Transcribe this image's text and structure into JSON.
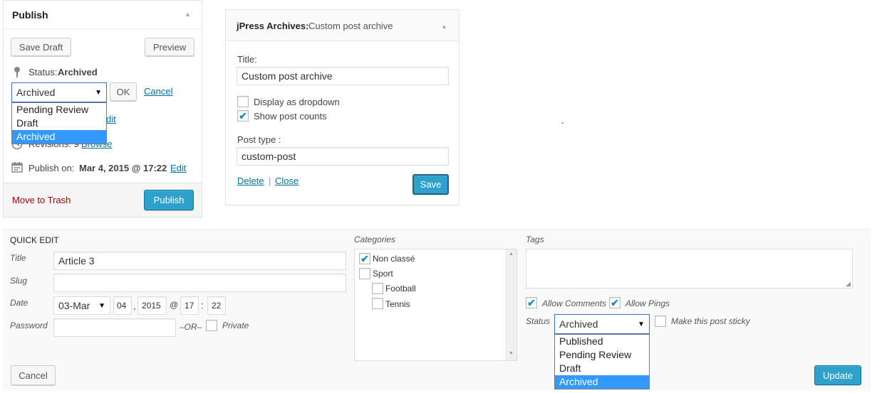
{
  "publish": {
    "title": "Publish",
    "save_draft": "Save Draft",
    "preview": "Preview",
    "status_label": "Status:",
    "status_value": "Archived",
    "status_select": "Archived",
    "status_options": [
      "Pending Review",
      "Draft",
      "Archived"
    ],
    "ok": "OK",
    "cancel": "Cancel",
    "hidden_edit_fragment": "dit",
    "revisions_label": "Revisions: 9",
    "browse": "Browse",
    "publish_on_label": "Publish on:",
    "publish_on_value": "Mar 4, 2015 @ 17:22",
    "edit": "Edit",
    "move_to_trash": "Move to Trash",
    "publish_button": "Publish"
  },
  "widget": {
    "name": "jPress Archives:",
    "subtitle": "Custom post archive",
    "title_label": "Title:",
    "title_value": "Custom post archive",
    "display_dropdown": "Display as dropdown",
    "show_counts": "Show post counts",
    "post_type_label": "Post type :",
    "post_type_value": "custom-post",
    "delete": "Delete",
    "separator": "|",
    "close": "Close",
    "save": "Save"
  },
  "stray_dot": ".",
  "quick_edit": {
    "heading": "QUICK EDIT",
    "title_label": "Title",
    "title_value": "Article 3",
    "slug_label": "Slug",
    "slug_value": "",
    "date_label": "Date",
    "date_month": "03-Mar",
    "date_day": "04",
    "date_comma": ",",
    "date_year": "2015",
    "date_at": "@",
    "date_hour": "17",
    "date_colon": ":",
    "date_minute": "22",
    "password_label": "Password",
    "password_value": "",
    "or_text": "–OR–",
    "private_label": "Private",
    "categories_label": "Categories",
    "categories": [
      {
        "name": "Non classé",
        "checked": true
      },
      {
        "name": "Sport",
        "checked": false
      },
      {
        "name": "Football",
        "checked": false
      },
      {
        "name": "Tennis",
        "checked": false
      }
    ],
    "tags_label": "Tags",
    "allow_comments": "Allow Comments",
    "allow_pings": "Allow Pings",
    "status_label": "Status",
    "status_select": "Archived",
    "status_options": [
      "Published",
      "Pending Review",
      "Draft",
      "Archived"
    ],
    "sticky_label": "Make this post sticky",
    "cancel": "Cancel",
    "update": "Update"
  },
  "icons": {
    "dropdown_arrow": "▼",
    "checkmark": "✔",
    "collapse": "▲"
  },
  "colors": {
    "primary": "#2ea2cc",
    "link": "#0074a2",
    "trash": "#a00",
    "selection": "#3399ff"
  }
}
